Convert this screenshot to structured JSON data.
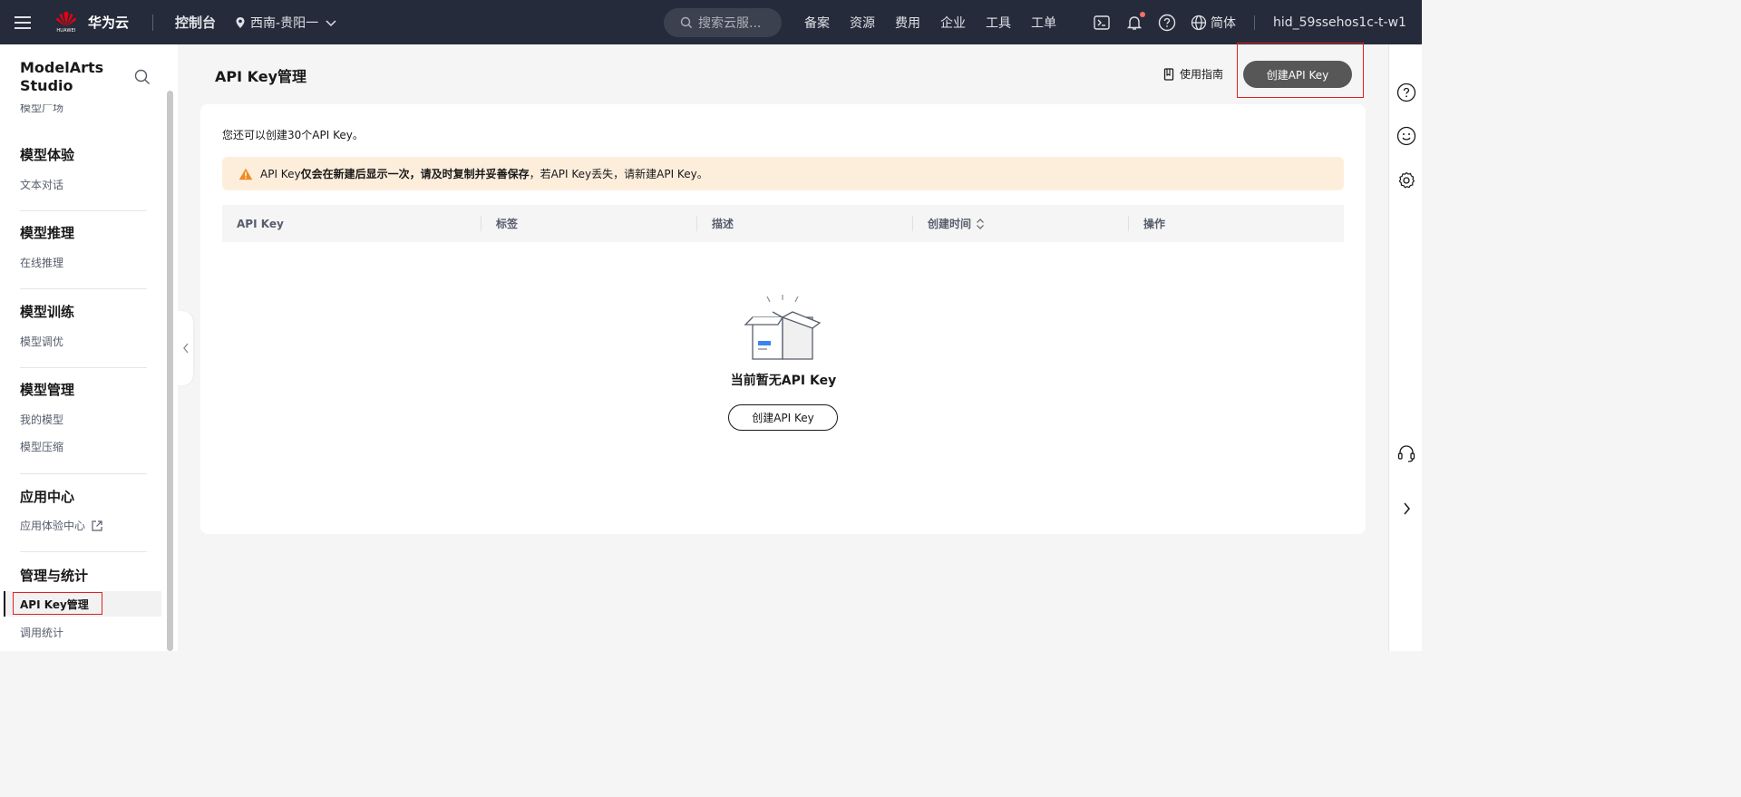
{
  "topbar": {
    "logo_text": "HUAWEI",
    "brand": "华为云",
    "console": "控制台",
    "region": "西南-贵阳一",
    "search_placeholder": "搜索云服...",
    "nav": [
      "备案",
      "资源",
      "费用",
      "企业",
      "工具",
      "工单"
    ],
    "language": "简体",
    "username": "hid_59ssehos1c-t-w1"
  },
  "sidebar": {
    "title": "ModelArts Studio",
    "cut_item": "模型广场",
    "groups": [
      {
        "title": "模型体验",
        "items": [
          "文本对话"
        ]
      },
      {
        "title": "模型推理",
        "items": [
          "在线推理"
        ]
      },
      {
        "title": "模型训练",
        "items": [
          "模型调优"
        ]
      },
      {
        "title": "模型管理",
        "items": [
          "我的模型",
          "模型压缩"
        ]
      },
      {
        "title": "应用中心",
        "items": [
          "应用体验中心"
        ]
      },
      {
        "title": "管理与统计",
        "items": [
          "API Key管理",
          "调用统计"
        ]
      }
    ]
  },
  "main": {
    "title": "API Key管理",
    "guide": "使用指南",
    "create_button": "创建API Key",
    "quota_text": "您还可以创建30个API Key。",
    "alert": {
      "prefix": "API Key",
      "bold": "仅会在新建后显示一次，请及时复制并妥善保存",
      "suffix": "，若API Key丢失，请新建API Key。"
    },
    "table": {
      "columns": [
        "API Key",
        "标签",
        "描述",
        "创建时间",
        "操作"
      ]
    },
    "empty": {
      "text": "当前暂无API Key",
      "button": "创建API Key"
    }
  },
  "colors": {
    "topbar_bg": "#252b3a",
    "primary_button": "#575757",
    "alert_bg": "#fdeedc",
    "warning": "#f08a24",
    "highlight_border": "#e02020"
  }
}
